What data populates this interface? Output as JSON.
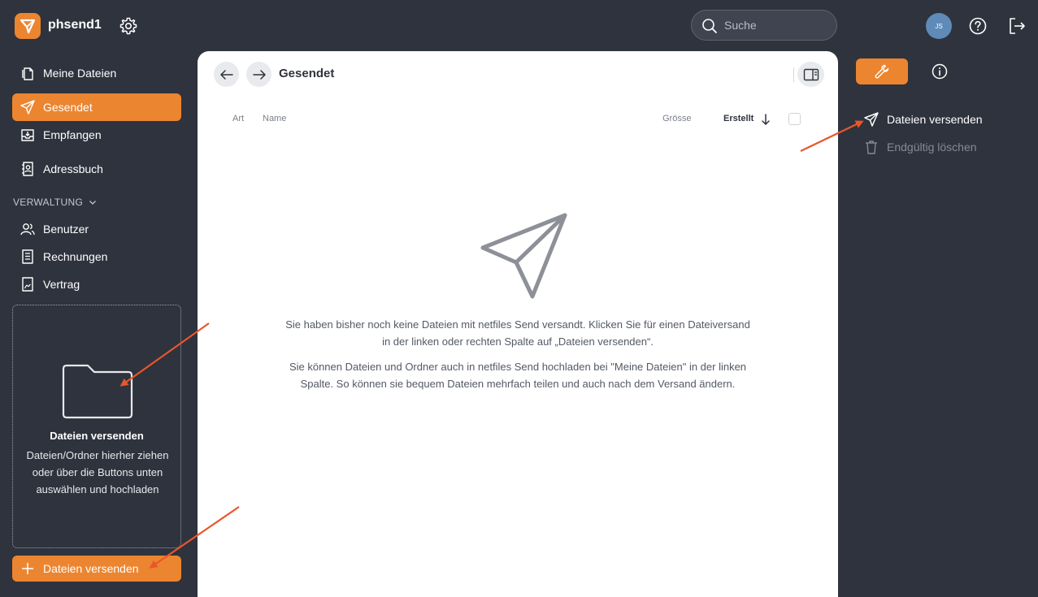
{
  "header": {
    "app_name": "phsend1",
    "search_placeholder": "Suche",
    "avatar_initials": "JS",
    "accent": "#ec8530"
  },
  "sidebar": {
    "items": [
      {
        "label": "Meine Dateien",
        "icon": "files-icon"
      },
      {
        "label": "Gesendet",
        "icon": "paper-plane-icon",
        "active": true
      },
      {
        "label": "Empfangen",
        "icon": "inbox-download-icon"
      },
      {
        "label": "Adressbuch",
        "icon": "address-book-icon"
      }
    ],
    "section_label": "VERWALTUNG",
    "admin_items": [
      {
        "label": "Benutzer",
        "icon": "users-icon"
      },
      {
        "label": "Rechnungen",
        "icon": "invoice-icon"
      },
      {
        "label": "Vertrag",
        "icon": "contract-icon"
      }
    ],
    "dropzone": {
      "title": "Dateien versenden",
      "text": "Dateien/Ordner hierher ziehen oder über die Buttons unten auswählen und hochladen"
    },
    "send_button": "Dateien versenden"
  },
  "main": {
    "title": "Gesendet",
    "columns": {
      "type": "Art",
      "name": "Name",
      "size": "Grösse",
      "created": "Erstellt"
    },
    "empty_text_1": "Sie haben bisher noch keine Dateien mit netfiles Send versandt. Klicken Sie für einen Dateiversand in der linken oder rechten Spalte auf „Dateien versenden“.",
    "empty_text_2": "Sie können Dateien und Ordner auch in netfiles Send hochladen bei \"Meine Dateien\" in der linken Spalte. So können sie bequem Dateien mehrfach teilen und auch nach dem Versand ändern."
  },
  "right_panel": {
    "actions": [
      {
        "label": "Dateien versenden",
        "icon": "paper-plane-icon",
        "enabled": true
      },
      {
        "label": "Endgültig löschen",
        "icon": "trash-icon",
        "enabled": false
      }
    ]
  }
}
